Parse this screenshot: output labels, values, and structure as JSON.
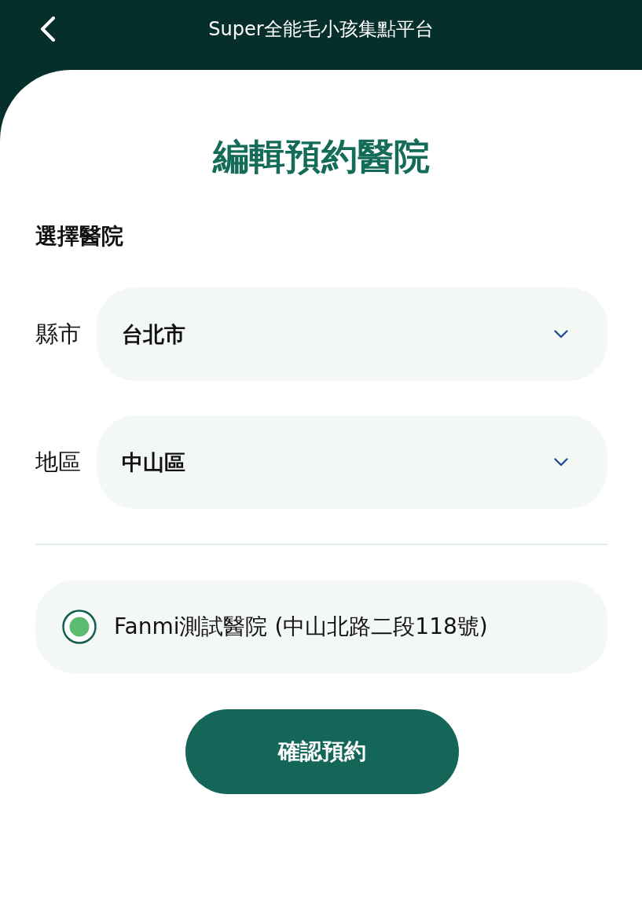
{
  "header": {
    "title": "Super全能毛小孩集點平台"
  },
  "page_title": "編輯預約醫院",
  "section_label": "選擇醫院",
  "selects": [
    {
      "label": "縣市",
      "value": "台北市"
    },
    {
      "label": "地區",
      "value": "中山區"
    }
  ],
  "hospitals": [
    {
      "name": "Fanmi測試醫院 (中山北路二段118號)",
      "selected": true
    }
  ],
  "confirm_button": "確認預約"
}
